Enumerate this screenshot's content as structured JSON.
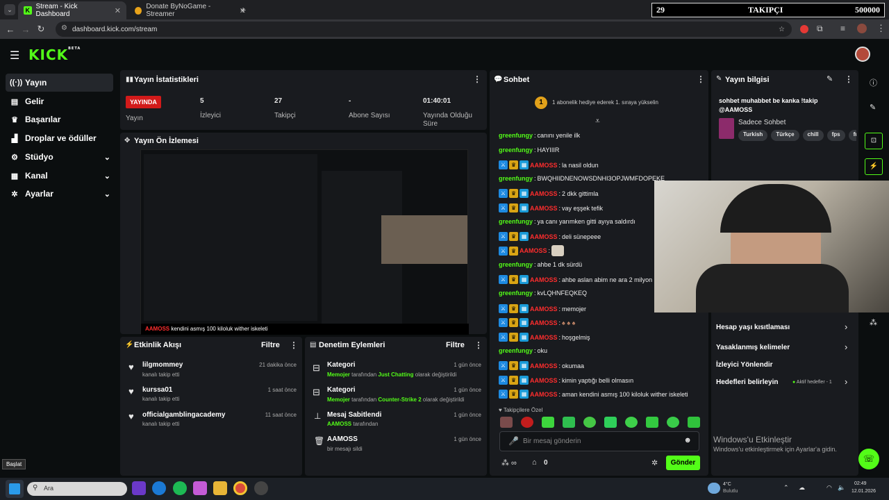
{
  "browser": {
    "tabs": [
      {
        "title": "Stream - Kick Dashboard"
      },
      {
        "title": "Donate ByNoGame - Streamer"
      }
    ],
    "url": "dashboard.kick.com/stream",
    "overlay": {
      "left": "29",
      "center": "TAKIPÇI",
      "right": "500000"
    }
  },
  "brand": {
    "logo": "KICK",
    "badge": "BETA",
    "color": "#53fc18"
  },
  "sidebar": {
    "items": [
      {
        "label": "Yayın",
        "icon": "broadcast-icon"
      },
      {
        "label": "Gelir",
        "icon": "wallet-icon"
      },
      {
        "label": "Başarılar",
        "icon": "trophy-icon"
      },
      {
        "label": "Droplar ve ödüller",
        "icon": "gift-icon"
      },
      {
        "label": "Stüdyo",
        "icon": "studio-icon"
      },
      {
        "label": "Kanal",
        "icon": "channel-icon"
      },
      {
        "label": "Ayarlar",
        "icon": "gear-icon"
      }
    ]
  },
  "stats": {
    "title": "Yayın İstatistikleri",
    "live_label": "YAYINDA",
    "items": [
      {
        "value": "",
        "label": "Yayın"
      },
      {
        "value": "5",
        "label": "İzleyici"
      },
      {
        "value": "27",
        "label": "Takipçi"
      },
      {
        "value": "-",
        "label": "Abone Sayısı"
      },
      {
        "value": "01:40:01",
        "label": "Yayında Olduğu Süre"
      }
    ]
  },
  "preview": {
    "title": "Yayın Ön İzlemesi",
    "caption_user": "AAMOSS",
    "caption_text": "kendini asmış 100 kiloluk wither iskeleti"
  },
  "activity": {
    "title": "Etkinlik Akışı",
    "filter": "Filtre",
    "items": [
      {
        "name": "lilgmommey",
        "sub": "kanalı takip etti",
        "time": "21 dakika önce"
      },
      {
        "name": "kurssa01",
        "sub": "kanalı takip etti",
        "time": "1 saat önce"
      },
      {
        "name": "officialgamblingacademy",
        "sub": "kanalı takip etti",
        "time": "11 saat önce"
      }
    ]
  },
  "moderation": {
    "title": "Denetim Eylemleri",
    "filter": "Filtre",
    "items": [
      {
        "title": "Kategori",
        "actor": "Memojer",
        "mid": "tarafından",
        "target": "Just Chatting",
        "end": "olarak değiştirildi",
        "time": "1 gün önce"
      },
      {
        "title": "Kategori",
        "actor": "Memojer",
        "mid": "tarafından",
        "target": "Counter-Strike 2",
        "end": "olarak değiştirildi",
        "time": "1 gün önce"
      },
      {
        "title": "Mesaj Sabitlendi",
        "actor": "AAMOSS",
        "mid": "tarafından",
        "target": "",
        "end": "",
        "time": "1 gün önce"
      },
      {
        "title": "AAMOSS",
        "actor": "",
        "mid": "bir mesajı sildi",
        "target": "",
        "end": "",
        "time": "1 gün önce"
      }
    ]
  },
  "chat": {
    "title": "Sohbet",
    "banner_badge": "1",
    "banner_text": "1 abonelik hediye ederek 1. sıraya yükselin",
    "messages": [
      {
        "user": "greenfungy",
        "type": "g",
        "text": "canını yenile ilk"
      },
      {
        "user": "greenfungy",
        "type": "g",
        "text": "HAYIIIR"
      },
      {
        "user": "AAMOSS",
        "type": "r",
        "text": "la nasil oldun"
      },
      {
        "user": "greenfungy",
        "type": "g",
        "text": "BWQHIIDNENOWSDNHI3OPJWMFDOPEKE"
      },
      {
        "user": "AAMOSS",
        "type": "r",
        "text": "2 dkk gittimla"
      },
      {
        "user": "AAMOSS",
        "type": "r",
        "text": "vay eşşek tefik"
      },
      {
        "user": "greenfungy",
        "type": "g",
        "text": "ya canı yarımken gitti ayıya saldırdı"
      },
      {
        "user": "AAMOSS",
        "type": "r",
        "text": "deli sünepeee"
      },
      {
        "user": "AAMOSS",
        "type": "r",
        "text": ""
      },
      {
        "user": "greenfungy",
        "type": "g",
        "text": "ahbe 1 dk sürdü"
      },
      {
        "user": "AAMOSS",
        "type": "r",
        "text": "ahbe aslan abim ne ara 2 milyon"
      },
      {
        "user": "greenfungy",
        "type": "g",
        "text": "kvLQHNFEQKEQ"
      },
      {
        "user": "AAMOSS",
        "type": "r",
        "text": "memojer"
      },
      {
        "user": "AAMOSS",
        "type": "r",
        "text": ""
      },
      {
        "user": "AAMOSS",
        "type": "r",
        "text": "hoşgelmiş"
      },
      {
        "user": "greenfungy",
        "type": "g",
        "text": "oku"
      },
      {
        "user": "AAMOSS",
        "type": "r",
        "text": "okumaa"
      },
      {
        "user": "AAMOSS",
        "type": "r",
        "text": "kimin yaptığı belli olmasın"
      },
      {
        "user": "AAMOSS",
        "type": "r",
        "text": "aman kendini asmış 100 kiloluk wither iskeleti"
      }
    ],
    "emote_section": "Takipçilere Özel",
    "input_placeholder": "Bir mesaj gönderin",
    "count": "0",
    "send": "Gönder"
  },
  "info": {
    "title": "Yayın bilgisi",
    "stream_title": "sohbet muhabbet be kanka !takip @AAMOSS",
    "category": "Sadece Sohbet",
    "tags": [
      "Turkish",
      "Türkçe",
      "chill",
      "fps",
      "fu"
    ],
    "menu": [
      {
        "label": "Hesap yaşı kısıtlaması",
        "extra": ""
      },
      {
        "label": "Yasaklanmış kelimeler",
        "extra": ""
      },
      {
        "label": "İzleyici Yönlendir",
        "extra": ""
      },
      {
        "label": "Hedefleri belirleyin",
        "extra": "Aktif hedefler - 1"
      }
    ]
  },
  "windows": {
    "activate_title": "Windows'u Etkinleştir",
    "activate_sub": "Windows'u etkinleştirmek için Ayarlar'a gidin.",
    "tooltip": "Başlat",
    "search": "Ara",
    "time": "02:49",
    "date": "12.01.2026",
    "weather": "4°C",
    "weather_sub": "Bulutlu"
  }
}
